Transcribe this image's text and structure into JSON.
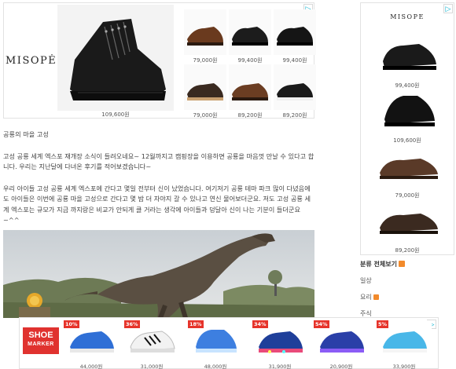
{
  "top_ad": {
    "brand": "MISOPĖ",
    "big_price": "109,600원",
    "prices": [
      "79,000원",
      "99,400원",
      "99,400원",
      "79,000원",
      "89,200원",
      "89,200원"
    ]
  },
  "article": {
    "heading": "공룡의 마을 고성",
    "para1": "고성 공룡 세계 엑스포 재개장 소식이 들려오네요~ 12월까지고 캠핑장을 이용하면 공룡을 마음껏 만날 수 있다고 합니다. 우리는 지난달에 다녀온 후기를 적어보겠습니다~",
    "para2": "우리 아이들 고성 공룡 세계 엑스포에 간다고 몇일 전부터 신이 났었습니다. 여기저기 공룡 테마 파크 많이 다녔음에도 아이들은 이번에 공룡 마을 고성으로 간다고 몇 밤 더 자야지 갈 수 있나고 연신 물어보더군요. 저도 고성 공룡 세계 엑스포는 규모가 지금 까지랑은 비교가 안되게 클 거라는 생각에 아이들과 덩달아 신이 나는 기분이 들더군요~^^"
  },
  "right_ad": {
    "brand": "MISOPE",
    "prices": [
      "99,400원",
      "109,600원",
      "79,000원",
      "89,200원"
    ]
  },
  "category": {
    "title": "분류 전체보기",
    "items": [
      "일상",
      "요리",
      "주식"
    ]
  },
  "bottom_ad": {
    "brand_line1": "SHOE",
    "brand_line2": "MARKER",
    "items": [
      {
        "discount": "10%",
        "price": "44,000원"
      },
      {
        "discount": "36%",
        "price": "31,000원"
      },
      {
        "discount": "18%",
        "price": "48,000원"
      },
      {
        "discount": "34%",
        "price": "31,900원"
      },
      {
        "discount": "54%",
        "price": "20,900원"
      },
      {
        "discount": "5%",
        "price": "33,900원"
      }
    ]
  },
  "colors": {
    "discount_badge": "#e6332a",
    "brand_red": "#e0322f",
    "rss": "#f28a2b",
    "adchoice": "#00aecd"
  },
  "icons": {
    "adchoice": "adchoices-icon",
    "rss": "rss-icon"
  }
}
